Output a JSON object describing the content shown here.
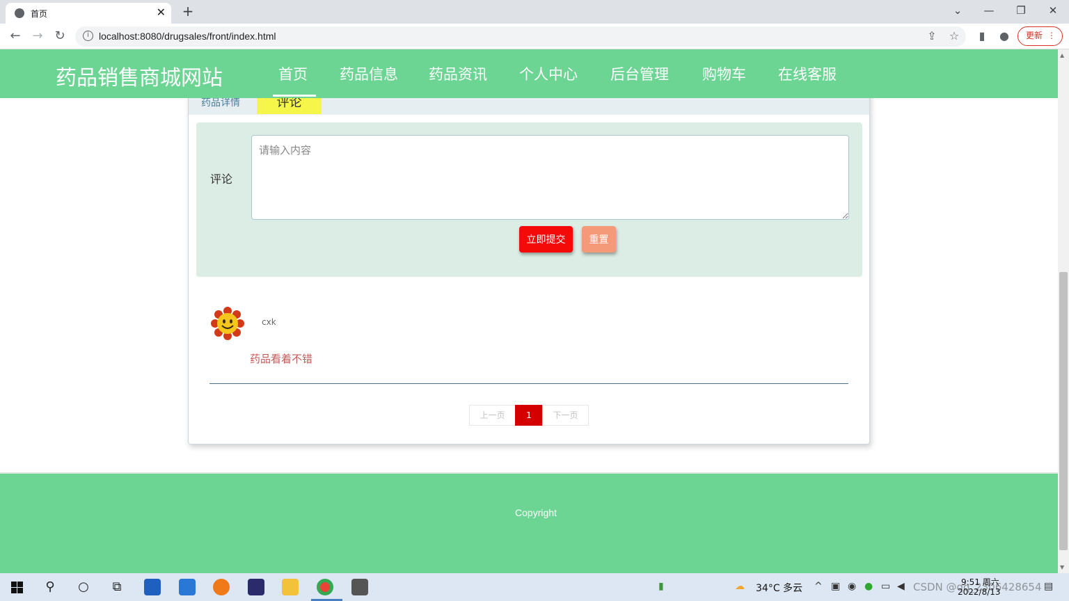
{
  "browser": {
    "tab_title": "首页",
    "tab_close": "✕",
    "new_tab": "+",
    "url": "localhost:8080/drugsales/front/index.html",
    "update_label": "更新",
    "update_menu": "⋮"
  },
  "site": {
    "title": "药品销售商城网站",
    "nav": [
      "首页",
      "药品信息",
      "药品资讯",
      "个人中心",
      "后台管理",
      "购物车",
      "在线客服"
    ]
  },
  "detail_tabs": {
    "detail": "药品详情",
    "comment": "评论"
  },
  "comment_form": {
    "label": "评论",
    "placeholder": "请输入内容",
    "submit": "立即提交",
    "reset": "重置"
  },
  "comments": [
    {
      "user": "cxk",
      "text": "药品看着不错"
    }
  ],
  "pagination": {
    "prev": "上一页",
    "current": "1",
    "next": "下一页"
  },
  "footer": {
    "copyright": "Copyright"
  },
  "taskbar": {
    "weather": "34°C  多云",
    "time": "9:51 周六",
    "date": "2022/8/13",
    "watermark": "CSDN @qq_2306428654"
  },
  "colors": {
    "brand_green": "#6dd593",
    "submit_red": "#f50a0a",
    "reset_salmon": "#f49a78",
    "active_tab_yellow": "#f5f54a",
    "page_active": "#d40000"
  }
}
